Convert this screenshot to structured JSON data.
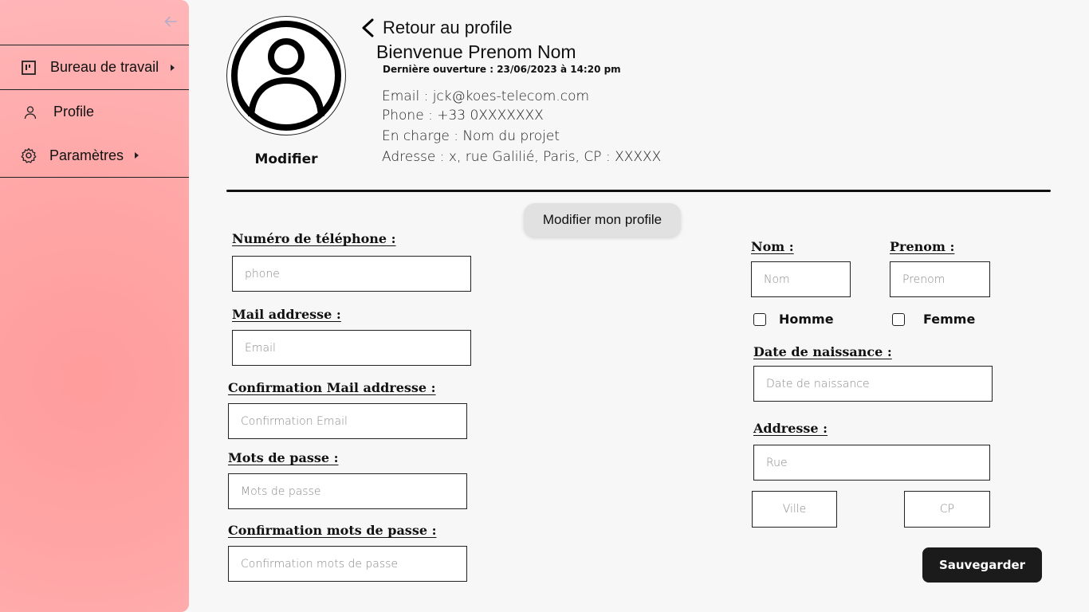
{
  "sidebar": {
    "items": [
      {
        "label": "Bureau de travail",
        "icon": "workspace-icon",
        "has_submenu": true
      },
      {
        "label": "Profile",
        "icon": "user-icon",
        "has_submenu": false
      },
      {
        "label": "Paramètres",
        "icon": "gear-icon",
        "has_submenu": true
      }
    ]
  },
  "header": {
    "back_link": "Retour au profile",
    "welcome": "Bienvenue Prenom Nom",
    "last_open": "Dernière ouverture : 23/06/2023 à 14:20 pm",
    "email": "Email : jck@koes-telecom.com",
    "phone": "Phone : +33 0XXXXXXX",
    "in_charge": "En charge : Nom du projet",
    "address": "Adresse : x, rue Galilié, Paris, CP : XXXXX",
    "avatar_action": "Modifier"
  },
  "form": {
    "title_button": "Modifier mon profile",
    "phone": {
      "label": "Numéro de téléphone :",
      "placeholder": "phone"
    },
    "mail": {
      "label": "Mail addresse :",
      "placeholder": "Email"
    },
    "mail_confirm": {
      "label": "Confirmation Mail addresse :",
      "placeholder": "Confirmation Email"
    },
    "password": {
      "label": "Mots de passe :",
      "placeholder": "Mots de passe"
    },
    "password_confirm": {
      "label": "Confirmation mots de passe :",
      "placeholder": "Confirmation mots de passe"
    },
    "nom": {
      "label": "Nom :",
      "placeholder": "Nom"
    },
    "prenom": {
      "label": "Prenom :",
      "placeholder": "Prenom"
    },
    "gender_male": "Homme",
    "gender_female": "Femme",
    "birthdate": {
      "label": "Date de naissance :",
      "placeholder": "Date de naissance"
    },
    "address": {
      "label": "Addresse :",
      "street_placeholder": "Rue",
      "city_placeholder": "Ville",
      "postcode_placeholder": "CP"
    },
    "save": "Sauvegarder"
  }
}
